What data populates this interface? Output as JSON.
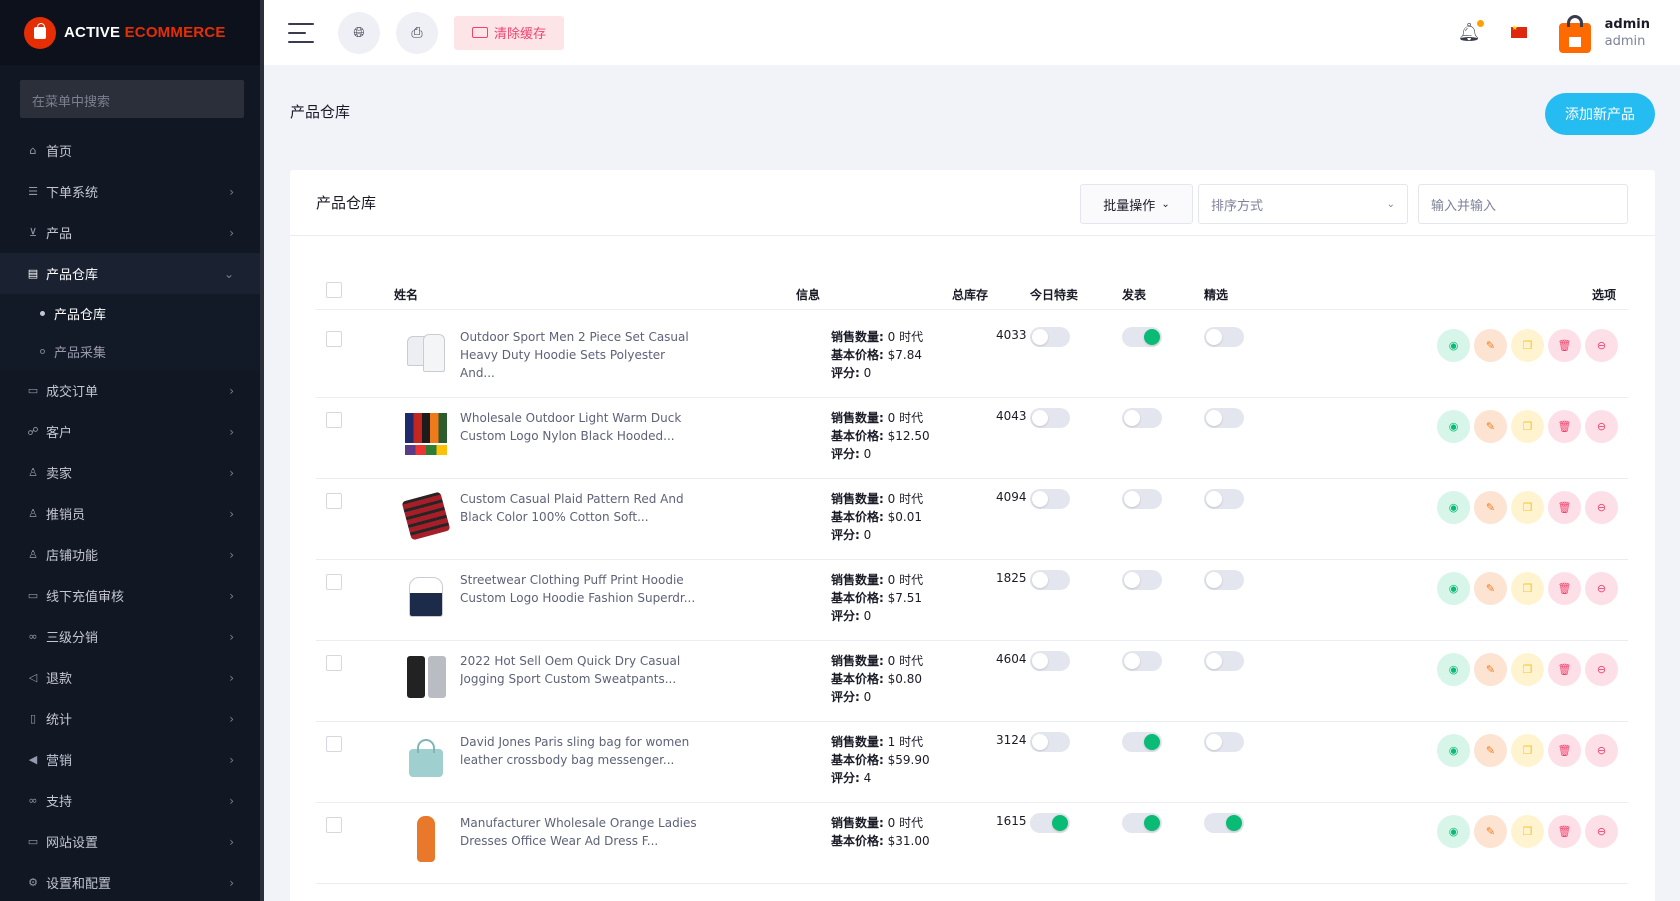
{
  "brand": {
    "part1": "ACTIVE ",
    "part2": "ECOMMERCE"
  },
  "sidebar": {
    "search_placeholder": "在菜单中搜索",
    "items": [
      {
        "label": "首页",
        "icon": "home-icon",
        "glyph": "⌂",
        "chevron": false
      },
      {
        "label": "下单系统",
        "icon": "list-icon",
        "glyph": "☰",
        "chevron": true
      },
      {
        "label": "产品",
        "icon": "cart-icon",
        "glyph": "⊻",
        "chevron": true
      },
      {
        "label": "产品仓库",
        "icon": "archive-icon",
        "glyph": "▤",
        "chevron": true,
        "expanded": true,
        "active": true
      },
      {
        "label": "成交订单",
        "icon": "receipt-icon",
        "glyph": "▭",
        "chevron": true
      },
      {
        "label": "客户",
        "icon": "users-icon",
        "glyph": "☍",
        "chevron": true
      },
      {
        "label": "卖家",
        "icon": "user-icon",
        "glyph": "♙",
        "chevron": true
      },
      {
        "label": "推销员",
        "icon": "user-icon",
        "glyph": "♙",
        "chevron": true
      },
      {
        "label": "店铺功能",
        "icon": "user-icon",
        "glyph": "♙",
        "chevron": true
      },
      {
        "label": "线下充值审核",
        "icon": "card-icon",
        "glyph": "▭",
        "chevron": true
      },
      {
        "label": "三级分销",
        "icon": "link-icon",
        "glyph": "∞",
        "chevron": true
      },
      {
        "label": "退款",
        "icon": "refund-icon",
        "glyph": "◁",
        "chevron": true
      },
      {
        "label": "统计",
        "icon": "file-icon",
        "glyph": "▯",
        "chevron": true
      },
      {
        "label": "营销",
        "icon": "megaphone-icon",
        "glyph": "◀",
        "chevron": true
      },
      {
        "label": "支持",
        "icon": "link-icon",
        "glyph": "∞",
        "chevron": true
      },
      {
        "label": "网站设置",
        "icon": "monitor-icon",
        "glyph": "▭",
        "chevron": true
      },
      {
        "label": "设置和配置",
        "icon": "settings-icon",
        "glyph": "⚙",
        "chevron": true
      }
    ],
    "submenu": [
      {
        "label": "产品仓库",
        "active": true
      },
      {
        "label": "产品采集",
        "active": false
      }
    ]
  },
  "topbar": {
    "clear_cache": "清除缓存",
    "user_name": "admin",
    "user_role": "admin"
  },
  "page": {
    "title": "产品仓库",
    "add_button": "添加新产品"
  },
  "card": {
    "title": "产品仓库",
    "bulk_action": "批量操作",
    "sort_placeholder": "排序方式",
    "search_placeholder": "输入并输入"
  },
  "table": {
    "headers": {
      "name": "姓名",
      "info": "信息",
      "stock": "总库存",
      "today_deal": "今日特卖",
      "published": "发表",
      "featured": "精选",
      "options": "选项"
    },
    "info_labels": {
      "sales": "销售数量:",
      "base_price": "基本价格:",
      "rating": "评分:"
    },
    "rows": [
      {
        "name": "Outdoor Sport Men 2 Piece Set Casual Heavy Duty Hoodie Sets Polyester And...",
        "sales": "0 时代",
        "price": "$7.84",
        "rating": "0",
        "stock": "4033",
        "today": false,
        "published": true,
        "featured": false,
        "thumb": "hoodie-white"
      },
      {
        "name": "Wholesale Outdoor Light Warm Duck Custom Logo Nylon Black Hooded...",
        "sales": "0 时代",
        "price": "$12.50",
        "rating": "0",
        "stock": "4043",
        "today": false,
        "published": false,
        "featured": false,
        "thumb": "jackets-multi"
      },
      {
        "name": "Custom Casual Plaid Pattern Red And Black Color 100% Cotton Soft...",
        "sales": "0 时代",
        "price": "$0.01",
        "rating": "0",
        "stock": "4094",
        "today": false,
        "published": false,
        "featured": false,
        "thumb": "plaid-shirt"
      },
      {
        "name": "Streetwear Clothing Puff Print Hoodie Custom Logo Hoodie Fashion Superdr...",
        "sales": "0 时代",
        "price": "$7.51",
        "rating": "0",
        "stock": "1825",
        "today": false,
        "published": false,
        "featured": false,
        "thumb": "hoodie-navy"
      },
      {
        "name": "2022 Hot Sell Oem Quick Dry Casual Jogging Sport Custom Sweatpants...",
        "sales": "0 时代",
        "price": "$0.80",
        "rating": "0",
        "stock": "4604",
        "today": false,
        "published": false,
        "featured": false,
        "thumb": "sweatpants"
      },
      {
        "name": "David Jones Paris sling bag for women leather crossbody bag messenger...",
        "sales": "1 时代",
        "price": "$59.90",
        "rating": "4",
        "stock": "3124",
        "today": false,
        "published": true,
        "featured": false,
        "thumb": "bag-teal"
      },
      {
        "name": "Manufacturer Wholesale Orange Ladies Dresses Office Wear Ad Dress F...",
        "sales": "0 时代",
        "price": "$31.00",
        "rating": "",
        "stock": "1615",
        "today": true,
        "published": true,
        "featured": true,
        "thumb": "dress-orange"
      }
    ]
  },
  "colors": {
    "accent": "#25bcf1",
    "brand_red": "#e62e04",
    "toggle_on": "#0abb75",
    "sidebar_bg": "#111723"
  }
}
